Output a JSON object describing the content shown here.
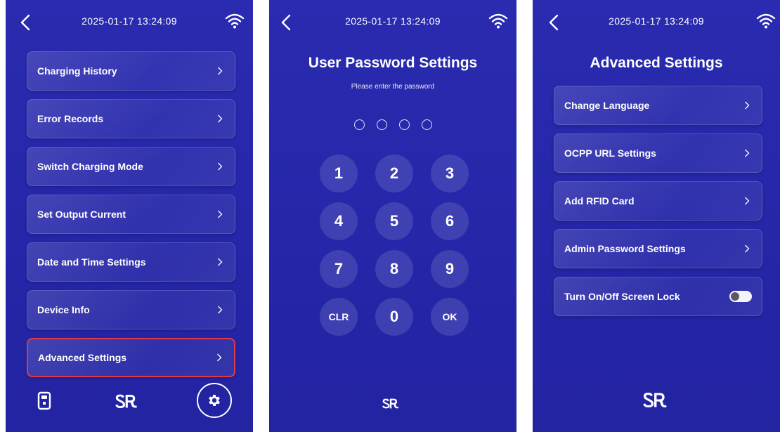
{
  "status": {
    "datetime": "2025-01-17 13:24:09"
  },
  "screen1": {
    "menu": [
      {
        "label": "Charging History"
      },
      {
        "label": "Error Records"
      },
      {
        "label": "Switch Charging Mode"
      },
      {
        "label": "Set Output Current"
      },
      {
        "label": "Date and Time Settings"
      },
      {
        "label": "Device Info"
      },
      {
        "label": "Advanced Settings",
        "highlighted": true
      }
    ]
  },
  "screen2": {
    "title": "User Password Settings",
    "subtitle": "Please enter the password",
    "keys": [
      "1",
      "2",
      "3",
      "4",
      "5",
      "6",
      "7",
      "8",
      "9",
      "CLR",
      "0",
      "OK"
    ]
  },
  "screen3": {
    "title": "Advanced Settings",
    "menu": [
      {
        "label": "Change Language"
      },
      {
        "label": "OCPP URL Settings"
      },
      {
        "label": "Add RFID Card"
      },
      {
        "label": "Admin Password Settings"
      },
      {
        "label": "Turn On/Off Screen Lock",
        "toggle": "off"
      }
    ]
  },
  "logo_text": "ᏚᎡ",
  "colors": {
    "background": "#2526a8",
    "highlight": "#e0394a",
    "text": "#ffffff"
  },
  "icons": {
    "back": "chevron-left-icon",
    "wifi": "wifi-icon",
    "chevron": "chevron-right-icon",
    "charger": "charger-icon",
    "settings": "gear-icon",
    "logo": "brand-logo"
  }
}
